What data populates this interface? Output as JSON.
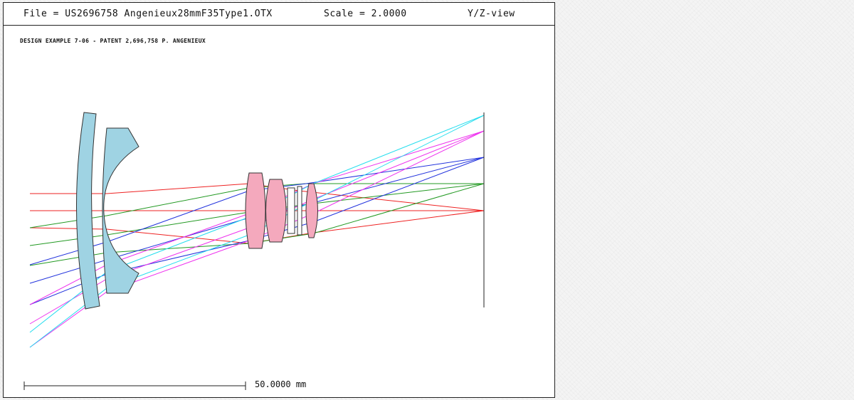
{
  "header": {
    "file_label": "File = US2696758 Angenieux28mmF35Type1.OTX",
    "scale_label": "Scale = 2.0000",
    "view_label": "Y/Z-view"
  },
  "design_title": "DESIGN EXAMPLE 7-06 - PATENT 2,696,758 P. ANGENIEUX",
  "scale_bar": {
    "label": "50.0000 mm"
  },
  "colors": {
    "crown_glass": "#9fd3e3",
    "flint_glass": "#f4a9bd",
    "ray_red": "#ee2222",
    "ray_green": "#229922",
    "ray_blue": "#2233dd",
    "ray_magenta": "#ee33ee",
    "ray_cyan": "#22ddee"
  }
}
